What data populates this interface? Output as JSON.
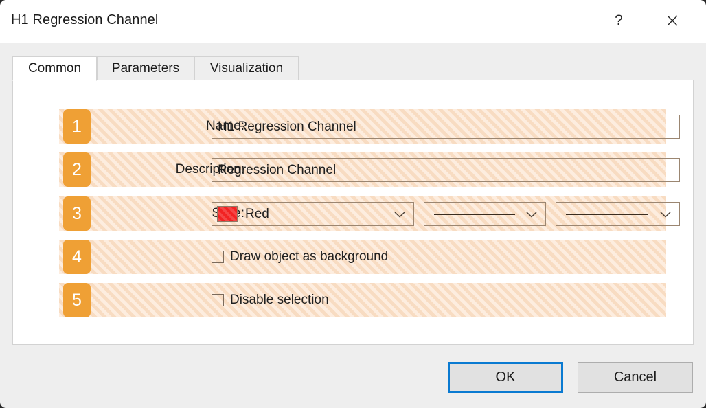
{
  "window": {
    "title": "H1 Regression Channel",
    "help_icon": "question-mark-icon",
    "close_icon": "close-icon"
  },
  "tabs": [
    {
      "label": "Common",
      "active": true
    },
    {
      "label": "Parameters",
      "active": false
    },
    {
      "label": "Visualization",
      "active": false
    }
  ],
  "rows": [
    {
      "badge": "1",
      "label": "Name:",
      "type": "text",
      "value": "H1 Regression Channel"
    },
    {
      "badge": "2",
      "label": "Description:",
      "type": "text",
      "value": "Regression Channel"
    },
    {
      "badge": "3",
      "label": "Style:",
      "type": "style",
      "color_value": "Red",
      "color_hex": "#f22222",
      "line_style_1": "solid-line",
      "line_style_2": "solid-line",
      "chevron_icon": "chevron-down-icon"
    },
    {
      "badge": "4",
      "label": "",
      "type": "checkbox",
      "checkbox_label": "Draw object as background",
      "checked": false
    },
    {
      "badge": "5",
      "label": "",
      "type": "checkbox",
      "checkbox_label": "Disable selection",
      "checked": false
    }
  ],
  "footer": {
    "ok_label": "OK",
    "cancel_label": "Cancel",
    "accent_color": "#0a7ad1"
  }
}
